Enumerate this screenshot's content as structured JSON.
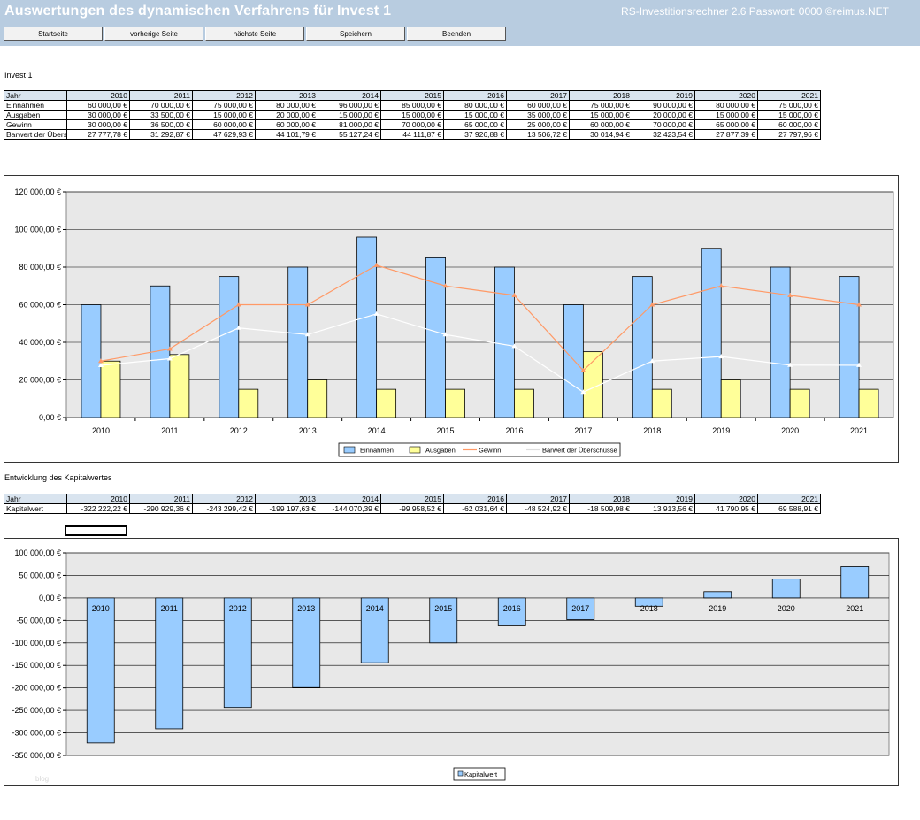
{
  "header": {
    "title": "Auswertungen des dynamischen Verfahrens für Invest 1",
    "info": "RS-Investitionsrechner 2.6   Passwort: 0000  ©reimus.NET"
  },
  "buttons": [
    "Startseite",
    "vorherige Seite",
    "nächste Seite",
    "Speichern",
    "Beenden"
  ],
  "section1_label": "Invest 1",
  "table1": {
    "header_label": "Jahr",
    "years": [
      "2010",
      "2011",
      "2012",
      "2013",
      "2014",
      "2015",
      "2016",
      "2017",
      "2018",
      "2019",
      "2020",
      "2021"
    ],
    "rows": [
      {
        "label": "Einnahmen",
        "values": [
          "60 000,00 €",
          "70 000,00 €",
          "75 000,00 €",
          "80 000,00 €",
          "96 000,00 €",
          "85 000,00 €",
          "80 000,00 €",
          "60 000,00 €",
          "75 000,00 €",
          "90 000,00 €",
          "80 000,00 €",
          "75 000,00 €"
        ]
      },
      {
        "label": "Ausgaben",
        "values": [
          "30 000,00 €",
          "33 500,00 €",
          "15 000,00 €",
          "20 000,00 €",
          "15 000,00 €",
          "15 000,00 €",
          "15 000,00 €",
          "35 000,00 €",
          "15 000,00 €",
          "20 000,00 €",
          "15 000,00 €",
          "15 000,00 €"
        ]
      },
      {
        "label": "Gewinn",
        "values": [
          "30 000,00 €",
          "36 500,00 €",
          "60 000,00 €",
          "60 000,00 €",
          "81 000,00 €",
          "70 000,00 €",
          "65 000,00 €",
          "25 000,00 €",
          "60 000,00 €",
          "70 000,00 €",
          "65 000,00 €",
          "60 000,00 €"
        ]
      },
      {
        "label": "Barwert der Überschüsse",
        "values": [
          "27 777,78 €",
          "31 292,87 €",
          "47 629,93 €",
          "44 101,79 €",
          "55 127,24 €",
          "44 111,87 €",
          "37 926,88 €",
          "13 506,72 €",
          "30 014,94 €",
          "32 423,54 €",
          "27 877,39 €",
          "27 797,96 €"
        ]
      }
    ]
  },
  "section2_label": "Entwicklung des Kapitalwertes",
  "table2": {
    "header_label": "Jahr",
    "years": [
      "2010",
      "2011",
      "2012",
      "2013",
      "2014",
      "2015",
      "2016",
      "2017",
      "2018",
      "2019",
      "2020",
      "2021"
    ],
    "rows": [
      {
        "label": "Kapitalwert",
        "values": [
          "-322 222,22 €",
          "-290 929,36 €",
          "-243 299,42 €",
          "-199 197,63 €",
          "-144 070,39 €",
          "-99 958,52 €",
          "-62 031,64 €",
          "-48 524,92 €",
          "-18 509,98 €",
          "13 913,56 €",
          "41 790,95 €",
          "69 588,91 €"
        ]
      }
    ]
  },
  "watermark": "blog",
  "chart_data": [
    {
      "type": "bar",
      "categories": [
        "2010",
        "2011",
        "2012",
        "2013",
        "2014",
        "2015",
        "2016",
        "2017",
        "2018",
        "2019",
        "2020",
        "2021"
      ],
      "series": [
        {
          "name": "Einnahmen",
          "kind": "bar",
          "color": "#99ccff",
          "values": [
            60000,
            70000,
            75000,
            80000,
            96000,
            85000,
            80000,
            60000,
            75000,
            90000,
            80000,
            75000
          ]
        },
        {
          "name": "Ausgaben",
          "kind": "bar",
          "color": "#ffff99",
          "values": [
            30000,
            33500,
            15000,
            20000,
            15000,
            15000,
            15000,
            35000,
            15000,
            20000,
            15000,
            15000
          ]
        },
        {
          "name": "Gewinn",
          "kind": "line",
          "color": "#ff9966",
          "values": [
            30000,
            36500,
            60000,
            60000,
            81000,
            70000,
            65000,
            25000,
            60000,
            70000,
            65000,
            60000
          ]
        },
        {
          "name": "Barwert der Überschüsse",
          "kind": "line",
          "color": "#ffffff",
          "values": [
            27777.78,
            31292.87,
            47629.93,
            44101.79,
            55127.24,
            44111.87,
            37926.88,
            13506.72,
            30014.94,
            32423.54,
            27877.39,
            27797.96
          ]
        }
      ],
      "yticks": [
        "0,00 €",
        "20 000,00 €",
        "40 000,00 €",
        "60 000,00 €",
        "80 000,00 €",
        "100 000,00 €",
        "120 000,00 €"
      ],
      "ylim": [
        0,
        120000
      ],
      "grid": true,
      "legend": "bottom"
    },
    {
      "type": "bar",
      "categories": [
        "2010",
        "2011",
        "2012",
        "2013",
        "2014",
        "2015",
        "2016",
        "2017",
        "2018",
        "2019",
        "2020",
        "2021"
      ],
      "series": [
        {
          "name": "Kapitalwert",
          "kind": "bar",
          "color": "#99ccff",
          "values": [
            -322222.22,
            -290929.36,
            -243299.42,
            -199197.63,
            -144070.39,
            -99958.52,
            -62031.64,
            -48524.92,
            -18509.98,
            13913.56,
            41790.95,
            69588.91
          ]
        }
      ],
      "yticks": [
        "-350 000,00 €",
        "-300 000,00 €",
        "-250 000,00 €",
        "-200 000,00 €",
        "-150 000,00 €",
        "-100 000,00 €",
        "-50 000,00 €",
        "0,00 €",
        "50 000,00 €",
        "100 000,00 €"
      ],
      "ylim": [
        -350000,
        100000
      ],
      "grid": true,
      "legend": "bottom"
    }
  ]
}
